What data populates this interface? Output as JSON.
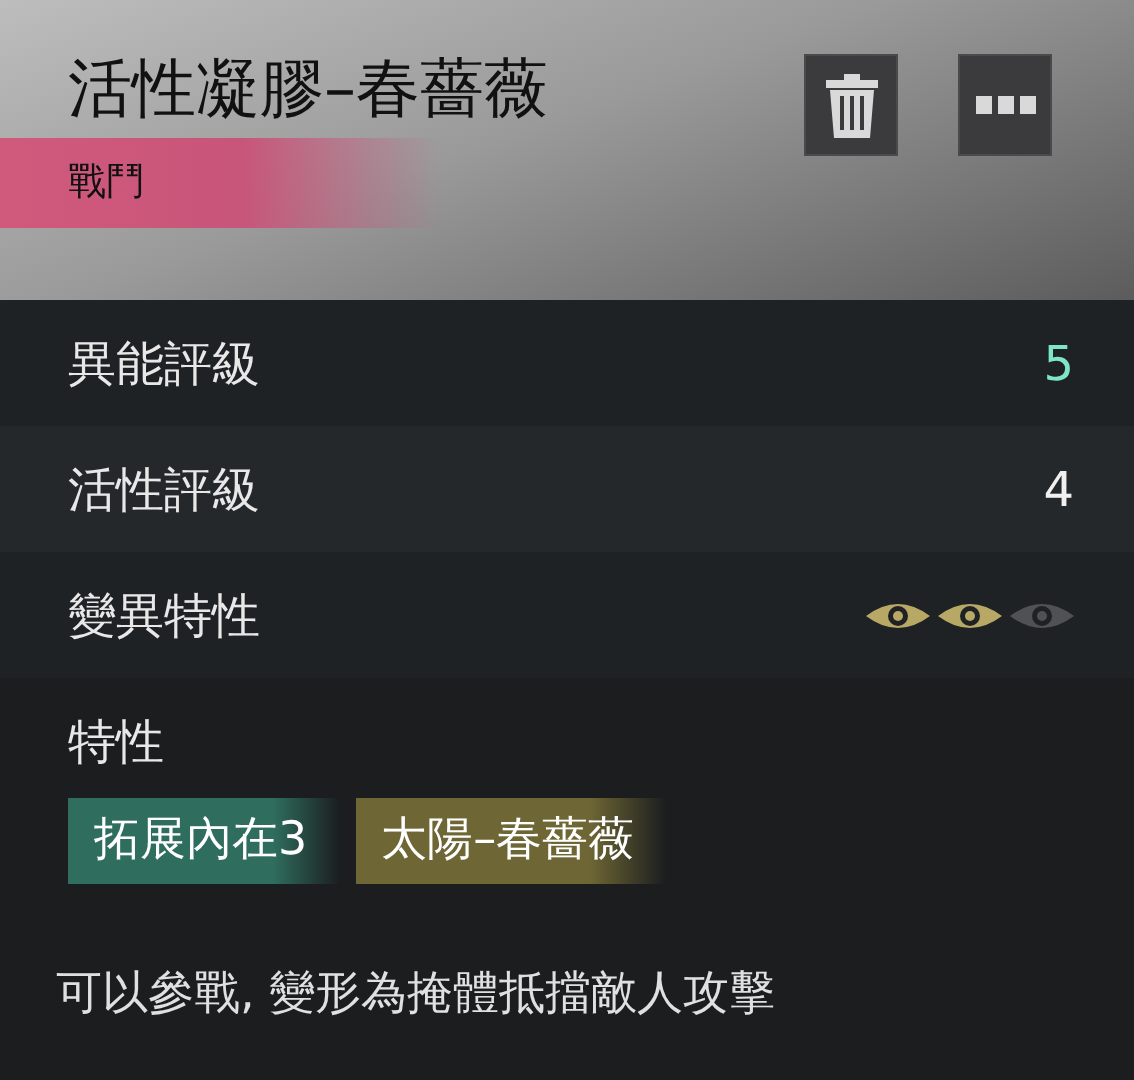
{
  "header": {
    "title": "活性凝膠–春薔薇",
    "category": "戰鬥"
  },
  "stats": [
    {
      "label": "異能評級",
      "kind": "value",
      "value": "5",
      "highlight": true
    },
    {
      "label": "活性評級",
      "kind": "value",
      "value": "4",
      "highlight": false
    },
    {
      "label": "變異特性",
      "kind": "eyes",
      "eyes": [
        {
          "on": true
        },
        {
          "on": true
        },
        {
          "on": false
        }
      ]
    }
  ],
  "traits": {
    "heading": "特性",
    "tags": [
      {
        "label": "拓展內在3",
        "color": "#2f6d5e"
      },
      {
        "label": "太陽–春薔薇",
        "color": "#6e6634"
      }
    ]
  },
  "description": "可以參戰, 變形為掩體抵擋敵人攻擊"
}
